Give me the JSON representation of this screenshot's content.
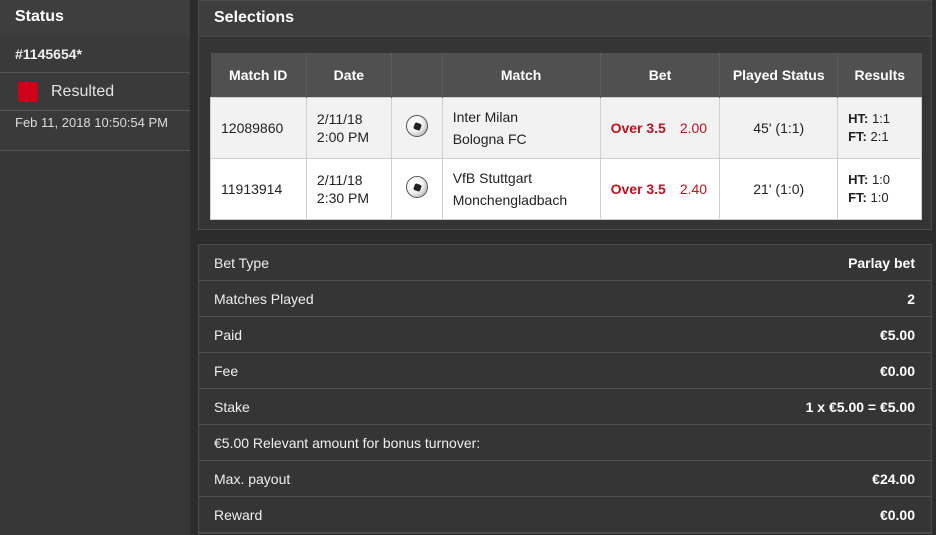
{
  "status_panel": {
    "title": "Status",
    "bet_id": "#1145654*",
    "status_text": "Resulted",
    "status_color": "#d0021b",
    "datetime": "Feb 11, 2018 10:50:54 PM"
  },
  "selections": {
    "title": "Selections",
    "columns": [
      "Match ID",
      "Date",
      "Match",
      "Bet",
      "Played Status",
      "Results"
    ],
    "rows": [
      {
        "match_id": "12089860",
        "date": "2/11/18",
        "time": "2:00 PM",
        "sport_icon": "soccer-ball-icon",
        "home": "Inter Milan",
        "away": "Bologna FC",
        "bet": "Over 3.5",
        "odds": "2.00",
        "played_status": "45' (1:1)",
        "ht_label": "HT:",
        "ht": "1:1",
        "ft_label": "FT:",
        "ft": "2:1"
      },
      {
        "match_id": "11913914",
        "date": "2/11/18",
        "time": "2:30 PM",
        "sport_icon": "soccer-ball-icon",
        "home": "VfB Stuttgart",
        "away": "Monchengladbach",
        "bet": "Over 3.5",
        "odds": "2.40",
        "played_status": "21' (1:0)",
        "ht_label": "HT:",
        "ht": "1:0",
        "ft_label": "FT:",
        "ft": "1:0"
      }
    ]
  },
  "details": [
    {
      "label": "Bet Type",
      "value": "Parlay bet"
    },
    {
      "label": "Matches Played",
      "value": "2"
    },
    {
      "label": "Paid",
      "value": "€5.00"
    },
    {
      "label": "Fee",
      "value": "€0.00"
    },
    {
      "label": "Stake",
      "value": "1 x €5.00 = €5.00"
    },
    {
      "label": "€5.00 Relevant amount for bonus turnover:",
      "value": ""
    },
    {
      "label": "Max. payout",
      "value": "€24.00"
    },
    {
      "label": "Reward",
      "value": "€0.00"
    }
  ],
  "colors": {
    "accent_red": "#c0111f",
    "panel_bg": "#353535",
    "header_bg": "#505050"
  }
}
